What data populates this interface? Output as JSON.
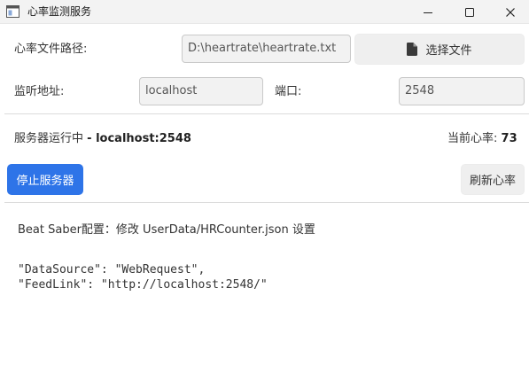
{
  "window": {
    "title": "心率监测服务"
  },
  "form": {
    "path_label": "心率文件路径:",
    "path_value": "D:\\heartrate\\heartrate.txt",
    "choose_file_label": "选择文件",
    "listen_label": "监听地址:",
    "listen_value": "localhost",
    "port_label": "端口:",
    "port_value": "2548"
  },
  "status": {
    "running_text": "服务器运行中",
    "address_text": "- localhost:2548",
    "hr_label": "当前心率:",
    "hr_value": "73"
  },
  "actions": {
    "stop_label": "停止服务器",
    "refresh_label": "刷新心率"
  },
  "config": {
    "info_text": "Beat Saber配置：修改 UserData/HRCounter.json 设置",
    "line1": "\"DataSource\": \"WebRequest\",",
    "line2": "\"FeedLink\": \"http://localhost:2548/\""
  },
  "colors": {
    "primary": "#2e74e8",
    "titlebar": "#f3f3f3"
  },
  "icons": {
    "app": "app-window-icon",
    "file": "file-icon",
    "minimize": "minimize-icon",
    "maximize": "maximize-icon",
    "close": "close-icon"
  }
}
